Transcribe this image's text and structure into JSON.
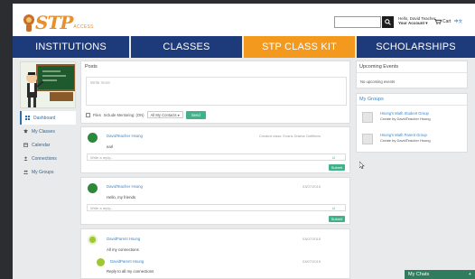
{
  "header": {
    "logo_text": "STP",
    "logo_sub": "ACCESS",
    "search": {
      "placeholder": ""
    },
    "account_greeting": "Hello, David Teacher",
    "account_link": "Your Account ▾",
    "cart_label": "Cart",
    "lang_label": "中文"
  },
  "nav": {
    "items": [
      {
        "label": "INSTITUTIONS",
        "color": "#1d3b7b"
      },
      {
        "label": "CLASSES",
        "color": "#1d3b7b"
      },
      {
        "label": "STP CLASS KIT",
        "color": "#f39a1e"
      },
      {
        "label": "SCHOLARSHIPS",
        "color": "#1d3b7b"
      }
    ]
  },
  "sidebar": {
    "items": [
      {
        "label": "Dashboard",
        "icon": "grid-icon",
        "active": true
      },
      {
        "label": "My Classes",
        "icon": "graduation-cap-icon"
      },
      {
        "label": "Calendar",
        "icon": "calendar-icon"
      },
      {
        "label": "Connections",
        "icon": "users-icon"
      },
      {
        "label": "My Groups",
        "icon": "group-icon"
      }
    ]
  },
  "posts": {
    "title": "Posts",
    "placeholder": "Write more",
    "files_label": "Files",
    "classroom_label": "Include Mentoring: (ON)",
    "select_label": "All My Contacts ▾",
    "send_label": "Send"
  },
  "feed": [
    {
      "author": "DavidTeacher Hsung",
      "meta": "Created class: Evans Drama Outfitters",
      "body": "earl",
      "reply_placeholder": "Write a reply...",
      "submit_label": "Submit",
      "avatar_color": "#2a8a3a"
    },
    {
      "author": "DavidTeacher Hsung",
      "meta": "03/07/2015",
      "body": "Hello, my friends",
      "reply_placeholder": "Write a reply...",
      "submit_label": "Submit",
      "avatar_color": "#2a8a3a"
    },
    {
      "author": "DavidParent Hsung",
      "meta": "03/07/2015",
      "body": "All my connections",
      "reply_author": "DavidParent Hsung",
      "reply_meta": "03/07/2015",
      "reply_body": "Reply to all my connections",
      "avatar_color": "#9bc92f"
    }
  ],
  "upcoming": {
    "title": "Upcoming Events",
    "empty_text": "No upcoming events"
  },
  "groups": {
    "title": "My Groups",
    "items": [
      {
        "name": "Hsung's Math Student Group",
        "owner": "Create by DavidTeacher Hsung"
      },
      {
        "name": "Hsung's Math Parent Group",
        "owner": "Create by DavidTeacher Hsung"
      }
    ]
  },
  "chat": {
    "label": "My Chats",
    "action": "+"
  }
}
